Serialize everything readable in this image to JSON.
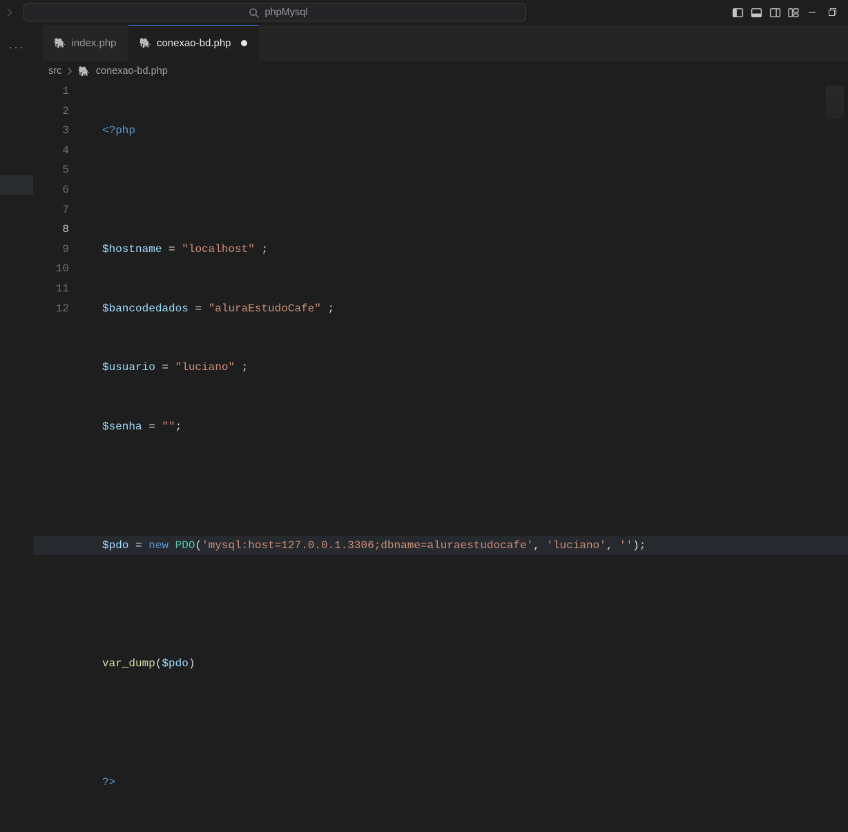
{
  "search": {
    "text": "phpMysql"
  },
  "tabs": [
    {
      "label": "index.php",
      "active": false,
      "dirty": false
    },
    {
      "label": "conexao-bd.php",
      "active": true,
      "dirty": true
    }
  ],
  "breadcrumbs": {
    "folder": "src",
    "file": "conexao-bd.php"
  },
  "editor": {
    "currentLine": 8,
    "lineNumbers": [
      "1",
      "2",
      "3",
      "4",
      "5",
      "6",
      "7",
      "8",
      "9",
      "10",
      "11",
      "12"
    ],
    "lines": {
      "l1": {
        "open": "<?php"
      },
      "l3": {
        "var": "$hostname",
        "eq": " = ",
        "str": "\"localhost\"",
        "tail": " ;"
      },
      "l4": {
        "var": "$bancodedados",
        "eq": " = ",
        "str": "\"aluraEstudoCafe\"",
        "tail": " ;"
      },
      "l5": {
        "var": "$usuario",
        "eq": " = ",
        "str": "\"luciano\"",
        "tail": " ;"
      },
      "l6": {
        "var": "$senha",
        "eq": " = ",
        "str": "\"\"",
        "tail": ";"
      },
      "l8": {
        "var": "$pdo",
        "eq": " = ",
        "kw": "new",
        "sp": " ",
        "cls": "PDO",
        "op": "(",
        "s1": "'mysql:host=127.0.0.1.3306;dbname=aluraestudocafe'",
        "c1": ", ",
        "s2": "'luciano'",
        "c2": ", ",
        "s3": "''",
        "cp": ");"
      },
      "l10": {
        "fn": "var_dump",
        "op": "(",
        "arg": "$pdo",
        "cp": ")"
      },
      "l12": {
        "close": "?>"
      }
    }
  }
}
